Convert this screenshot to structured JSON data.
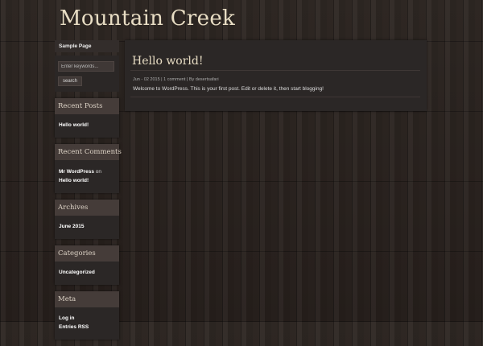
{
  "site": {
    "title": "Mountain Creek"
  },
  "pages": {
    "sample_page": "Sample Page"
  },
  "search": {
    "placeholder": "Enter keywords...",
    "button": "search"
  },
  "widgets": {
    "recent_posts": {
      "title": "Recent Posts",
      "items": [
        "Hello world!"
      ]
    },
    "recent_comments": {
      "title": "Recent Comments",
      "author": "Mr WordPress",
      "connector": "on",
      "post": "Hello world!"
    },
    "archives": {
      "title": "Archives",
      "items": [
        "June 2015"
      ]
    },
    "categories": {
      "title": "Categories",
      "items": [
        "Uncategorized"
      ]
    },
    "meta": {
      "title": "Meta",
      "items": [
        "Log in",
        "Entries RSS"
      ]
    }
  },
  "post": {
    "title": "Hello world!",
    "date": "Jun - 02 2015",
    "sep1": "|",
    "comments": "1 comment",
    "sep2": "|",
    "by": "By desertsafari",
    "body": "Welcome to WordPress. This is your first post. Edit or delete it, then start blogging!"
  },
  "colors": {
    "background": "#2a2320",
    "panel": "#2b2726",
    "widget_header": "#453c39",
    "title_text": "#e8ddc4"
  }
}
